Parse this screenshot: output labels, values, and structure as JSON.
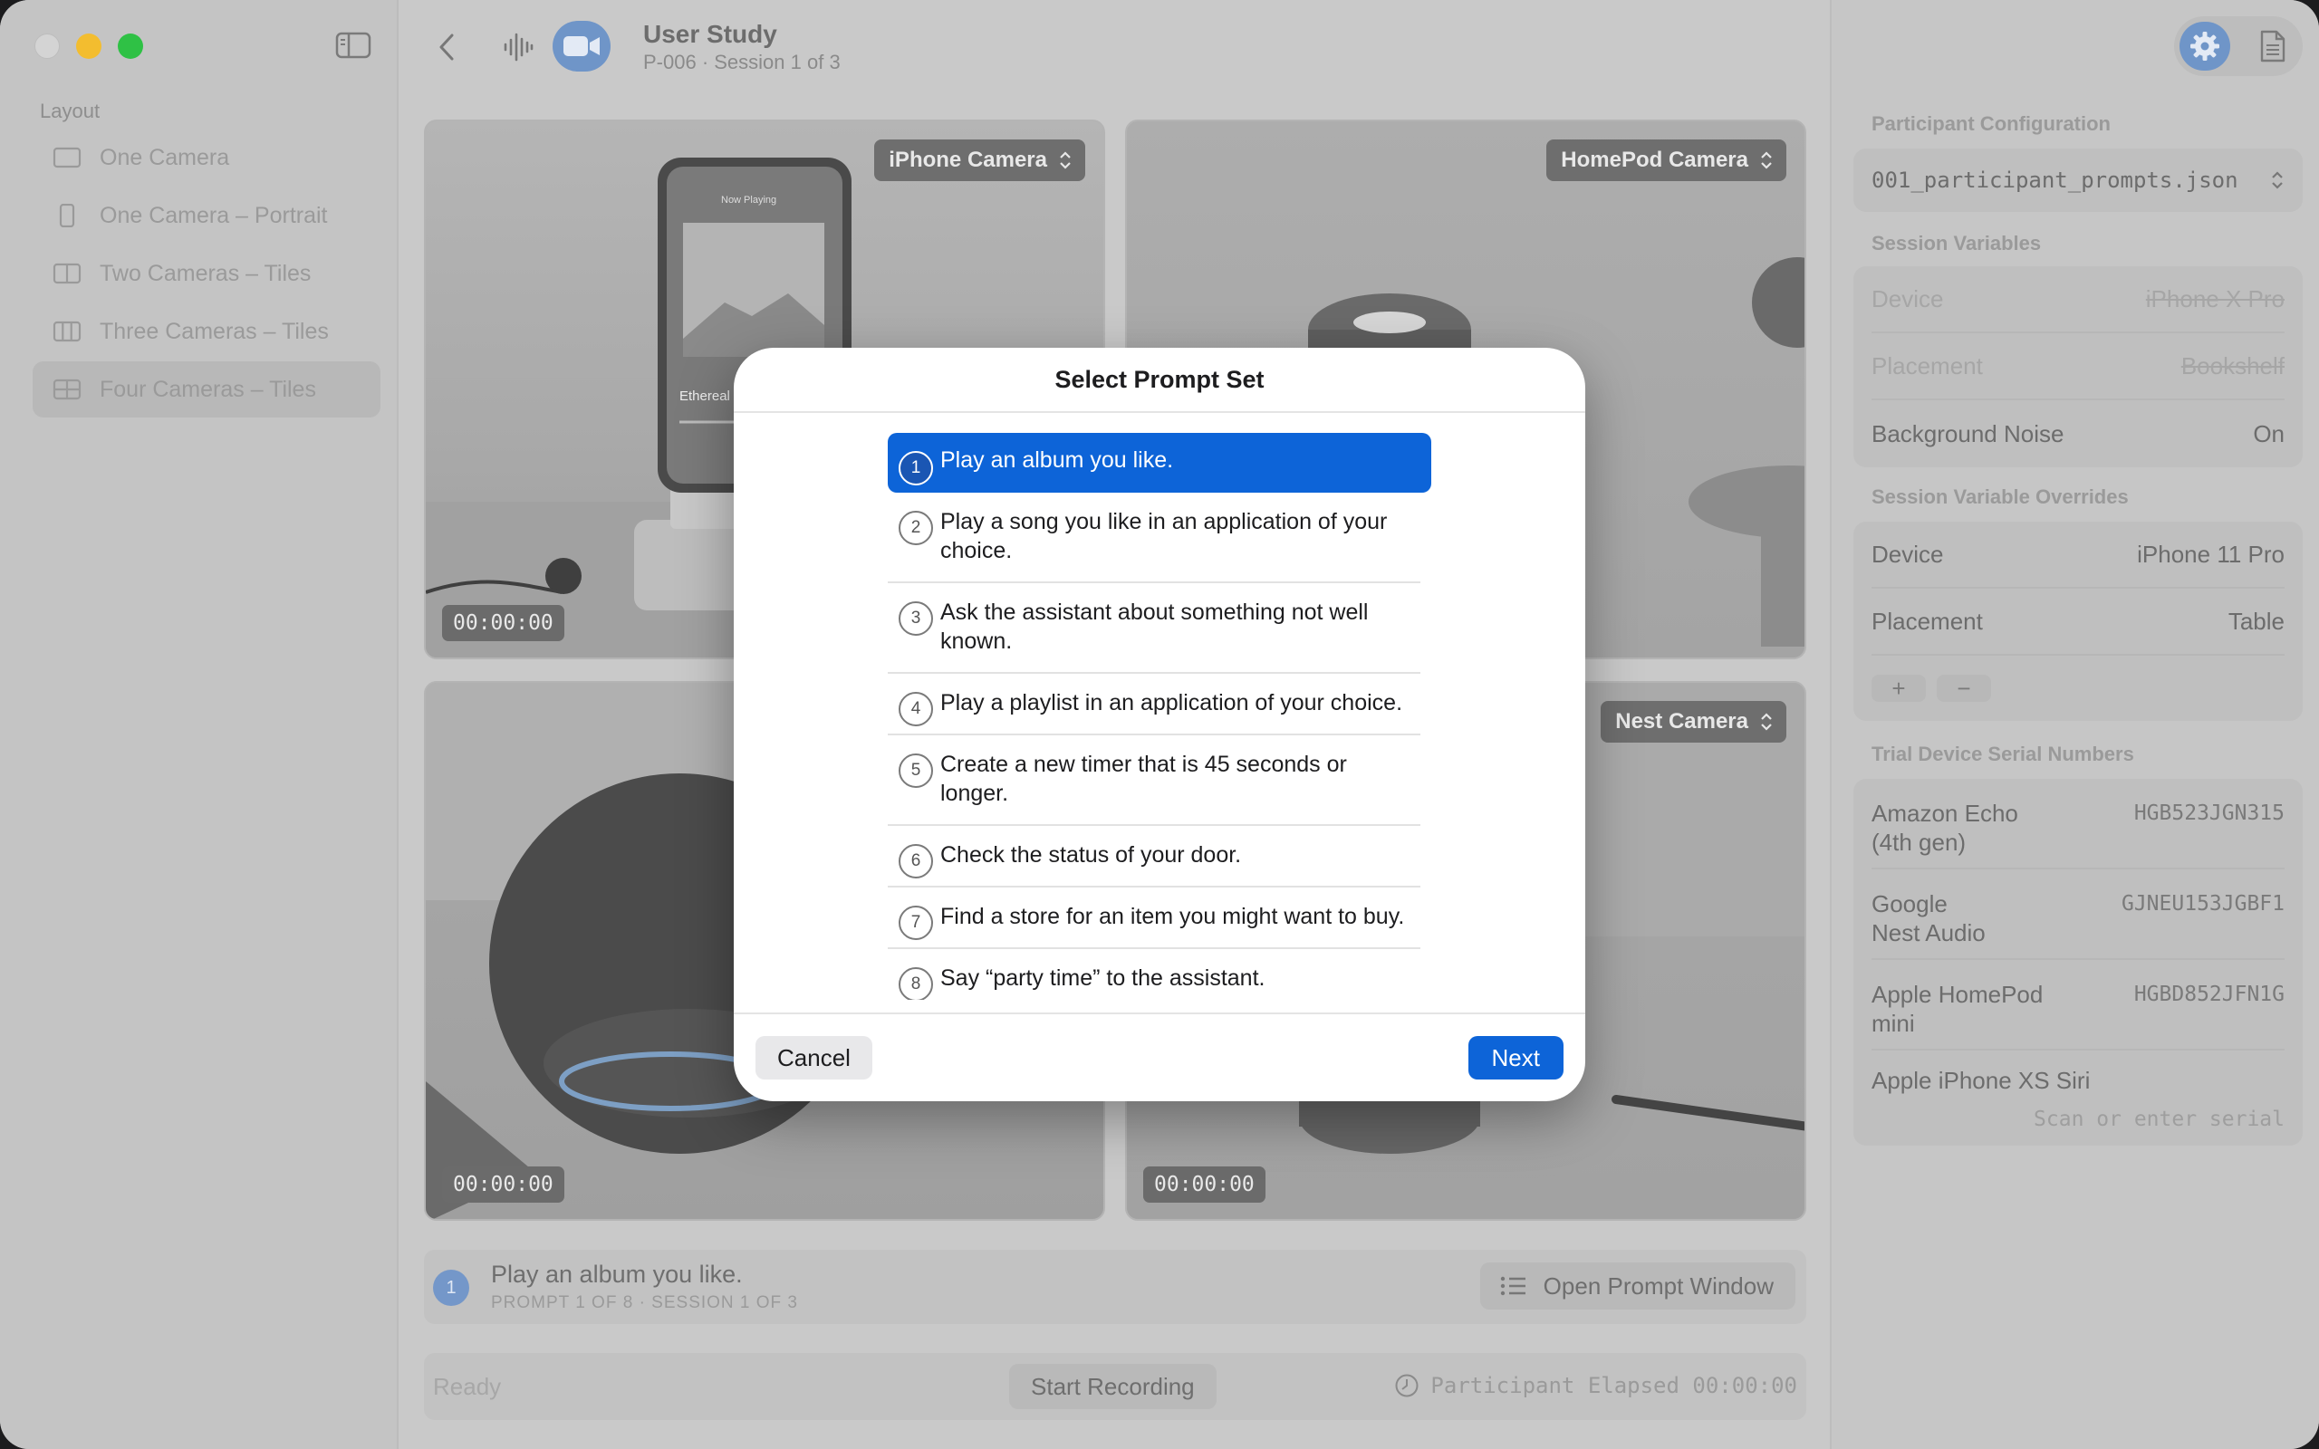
{
  "sidebar": {
    "section_label": "Layout",
    "items": [
      {
        "label": "One Camera",
        "icon": "single-pane-icon"
      },
      {
        "label": "One Camera – Portrait",
        "icon": "portrait-pane-icon"
      },
      {
        "label": "Two Cameras – Tiles",
        "icon": "two-tiles-icon"
      },
      {
        "label": "Three Cameras – Tiles",
        "icon": "three-tiles-icon"
      },
      {
        "label": "Four Cameras – Tiles",
        "icon": "four-tiles-icon",
        "selected": true
      }
    ]
  },
  "toolbar": {
    "title": "User Study",
    "subtitle": "P-006 · Session 1 of 3"
  },
  "cameras": [
    {
      "label": "iPhone Camera",
      "timecode": "00:00:00"
    },
    {
      "label": "HomePod Camera",
      "timecode": "00:00:00"
    },
    {
      "label": "",
      "timecode": "00:00:00"
    },
    {
      "label": "Nest Camera",
      "timecode": "00:00:00"
    }
  ],
  "prompt_bar": {
    "number": "1",
    "title": "Play an album you like.",
    "subtitle": "PROMPT 1 OF 8 · SESSION 1 OF 3",
    "open_button": "Open Prompt Window"
  },
  "status_bar": {
    "status": "Ready",
    "record_button": "Start Recording",
    "elapsed": "Participant Elapsed 00:00:00"
  },
  "inspector": {
    "participant_config_heading": "Participant Configuration",
    "config_file": "001_participant_prompts.json",
    "session_vars_heading": "Session Variables",
    "session_vars": [
      {
        "label": "Device",
        "value": "iPhone X Pro",
        "overridden": true
      },
      {
        "label": "Placement",
        "value": "Bookshelf",
        "overridden": true
      },
      {
        "label": "Background Noise",
        "value": "On",
        "overridden": false
      }
    ],
    "overrides_heading": "Session Variable Overrides",
    "overrides": [
      {
        "label": "Device",
        "value": "iPhone 11 Pro"
      },
      {
        "label": "Placement",
        "value": "Table"
      }
    ],
    "add_label": "+",
    "remove_label": "−",
    "serials_heading": "Trial Device Serial Numbers",
    "serials": [
      {
        "label": "Amazon Echo (4th gen)",
        "line1": "Amazon Echo",
        "line2": "(4th gen)",
        "value": "HGB523JGN315"
      },
      {
        "label": "Google Nest Audio",
        "line1": "Google",
        "line2": "Nest Audio",
        "value": "GJNEU153JGBF1"
      },
      {
        "label": "Apple HomePod mini",
        "line1": "Apple HomePod",
        "line2": "mini",
        "value": "HGBD852JFN1G"
      }
    ],
    "last_serial_label": "Apple iPhone XS Siri",
    "last_serial_placeholder": "Scan or enter serial"
  },
  "modal": {
    "title": "Select Prompt Set",
    "prompts": [
      {
        "n": "1",
        "text": "Play an album you like."
      },
      {
        "n": "2",
        "text": "Play a song you like in an application of your choice."
      },
      {
        "n": "3",
        "text": "Ask the assistant about something not well known."
      },
      {
        "n": "4",
        "text": "Play a playlist in an application of your choice."
      },
      {
        "n": "5",
        "text": "Create a new timer that is 45 seconds or longer."
      },
      {
        "n": "6",
        "text": "Check the status of your door."
      },
      {
        "n": "7",
        "text": "Find a store for an item you might want to buy."
      },
      {
        "n": "8",
        "text": "Say “party time” to the assistant."
      }
    ],
    "selected_index": 0,
    "cancel_label": "Cancel",
    "next_label": "Next"
  },
  "colors": {
    "accent": "#0d64d8",
    "traffic_close": "#d4d4d4",
    "traffic_minimize": "#f3bd2f",
    "traffic_maximize": "#2fc145"
  }
}
